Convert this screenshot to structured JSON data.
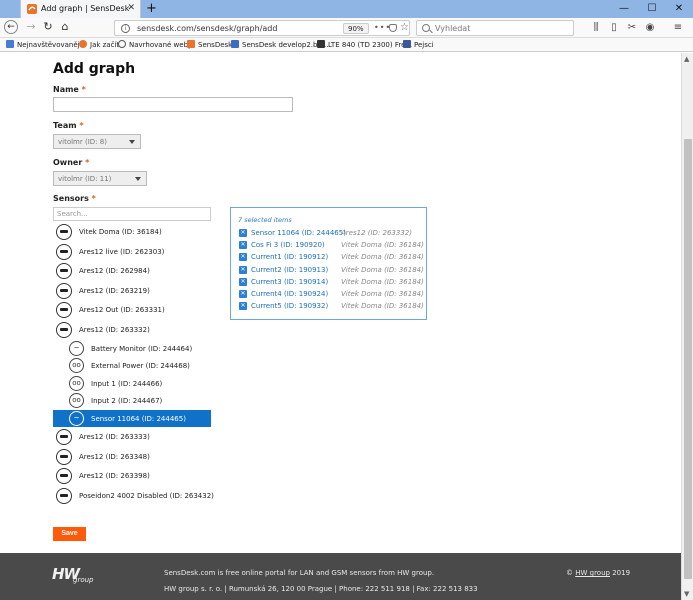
{
  "browser": {
    "tab_title": "Add graph | SensDesk",
    "url": "sensdesk.com/sensdesk/graph/add",
    "zoom": "90%",
    "search_placeholder": "Vyhledat",
    "bookmarks": [
      {
        "label": "Nejnavštěvovanější",
        "color": "#4a7bd4"
      },
      {
        "label": "Jak začít",
        "color": "#e8732a"
      },
      {
        "label": "Navrhované weby",
        "color": "#555555"
      },
      {
        "label": "SensDesk",
        "color": "#e8732a"
      },
      {
        "label": "SensDesk develop2.be...",
        "color": "#3a6cc8"
      },
      {
        "label": "LTE 840 (TD 2300) Fre...",
        "color": "#333333"
      },
      {
        "label": "Pejsci",
        "color": "#3b5998"
      }
    ]
  },
  "form": {
    "title": "Add graph",
    "name_label": "Name",
    "team_label": "Team",
    "team_value": "vitolmr (ID: 8)",
    "owner_label": "Owner",
    "owner_value": "vitolmr (ID: 11)",
    "sensors_label": "Sensors",
    "required_mark": "*",
    "search_placeholder": "Search...",
    "save_label": "Save"
  },
  "tree": {
    "devices_top": [
      "Vitek Doma (ID: 36184)",
      "Ares12 live (ID: 262303)",
      "Ares12 (ID: 262984)",
      "Ares12 (ID: 263219)",
      "Ares12 Out (ID: 263331)",
      "Ares12 (ID: 263332)"
    ],
    "sensors": [
      {
        "label": "Battery Monitor (ID: 244464)",
        "icon": "~"
      },
      {
        "label": "External Power (ID: 244468)",
        "icon": "oo"
      },
      {
        "label": "Input 1 (ID: 244466)",
        "icon": "oo"
      },
      {
        "label": "Input 2 (ID: 244467)",
        "icon": "oo"
      },
      {
        "label": "Sensor 11064 (ID: 244465)",
        "icon": "~"
      }
    ],
    "devices_bottom": [
      "Ares12 (ID: 263333)",
      "Ares12 (ID: 263348)",
      "Ares12 (ID: 263398)",
      "Poseidon2 4002 Disabled (ID: 263432)"
    ]
  },
  "selected": {
    "header": "7 selected items",
    "remove_glyph": "✕",
    "items": [
      {
        "name": "Sensor 11064 (ID: 244465)",
        "device": "Ares12 (ID: 263332)"
      },
      {
        "name": "Cos Fi 3 (ID: 190920)",
        "device": "Vitek Doma (ID: 36184)"
      },
      {
        "name": "Current1 (ID: 190912)",
        "device": "Vitek Doma (ID: 36184)"
      },
      {
        "name": "Current2 (ID: 190913)",
        "device": "Vitek Doma (ID: 36184)"
      },
      {
        "name": "Current3 (ID: 190914)",
        "device": "Vitek Doma (ID: 36184)"
      },
      {
        "name": "Current4 (ID: 190924)",
        "device": "Vitek Doma (ID: 36184)"
      },
      {
        "name": "Current5 (ID: 190932)",
        "device": "Vitek Doma (ID: 36184)"
      }
    ]
  },
  "footer": {
    "logo": "HW",
    "logo_sub": "group",
    "line1": "SensDesk.com is free online portal for LAN and GSM sensors from HW group.",
    "line2": "HW group s. r. o.  |  Rumunská 26, 120 00 Prague  |  Phone: 222 511 918  |  Fax: 222 513 833",
    "copy_symbol": "©",
    "copy_link": "HW group",
    "copy_year": "2019"
  },
  "colors": {
    "accent": "#ff5a0a",
    "selected_bg": "#0f72c8",
    "link": "#1e6fc0",
    "footer_bg": "#4a4a4a"
  }
}
